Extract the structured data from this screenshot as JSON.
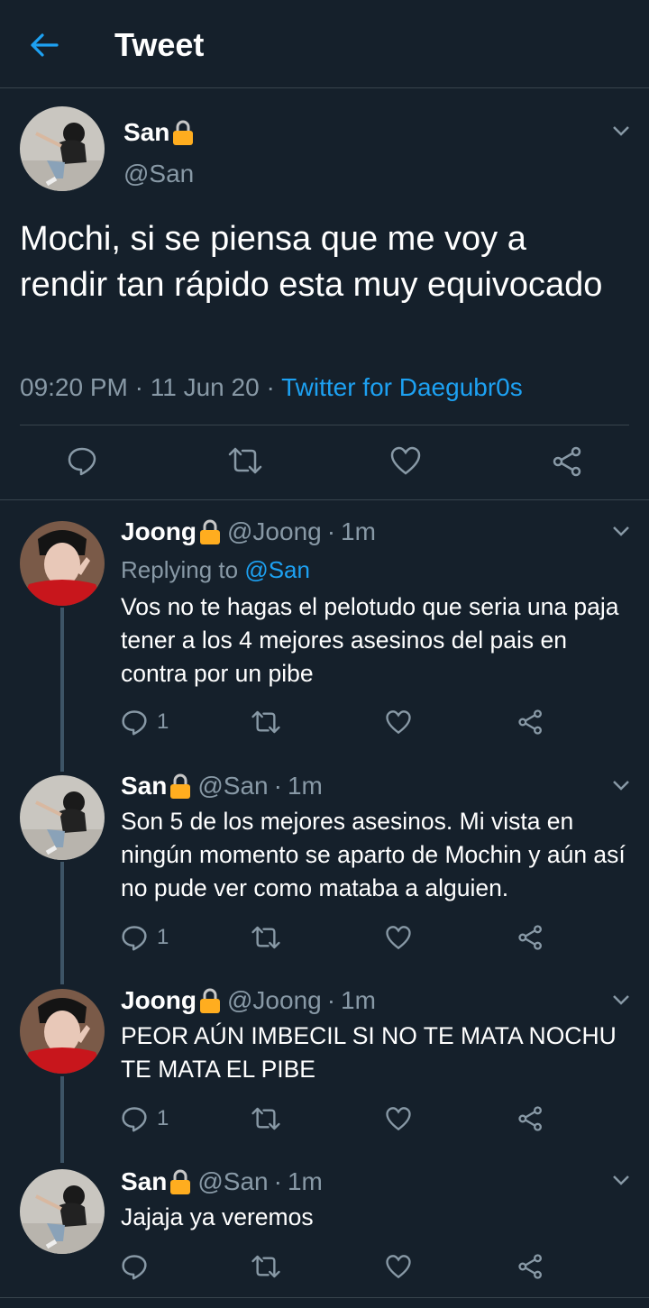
{
  "header": {
    "title": "Tweet",
    "back_icon": "back-arrow-icon"
  },
  "main_tweet": {
    "name": "San",
    "handle": "@San",
    "text": "Mochi, si se piensa que me voy a rendir tan rápido esta muy equivocado",
    "time": "09:20 PM",
    "date": "11 Jun 20",
    "source": "Twitter for Daegubr0s",
    "sep": "·"
  },
  "replies": [
    {
      "name": "Joong",
      "handle": "@Joong",
      "time": "1m",
      "replying_label": "Replying to",
      "replying_to": "@San",
      "text": "Vos no te hagas el pelotudo que seria una paja tener a los 4 mejores asesinos del pais en contra por un pibe",
      "reply_count": "1"
    },
    {
      "name": "San",
      "handle": "@San",
      "time": "1m",
      "text": "Son 5 de los mejores asesinos. Mi vista en ningún momento se aparto de Mochin y aún así no pude ver como mataba a alguien.",
      "reply_count": "1"
    },
    {
      "name": "Joong",
      "handle": "@Joong",
      "time": "1m",
      "text": "PEOR AÚN IMBECIL SI NO TE MATA NOCHU TE MATA EL PIBE",
      "reply_count": "1"
    },
    {
      "name": "San",
      "handle": "@San",
      "time": "1m",
      "text": "Jajaja ya veremos",
      "reply_count": ""
    }
  ],
  "colors": {
    "background": "#15202b",
    "accent": "#1da1f2",
    "secondary_text": "#8899a6",
    "divider": "#38444d",
    "lock": "#ffad1f"
  }
}
